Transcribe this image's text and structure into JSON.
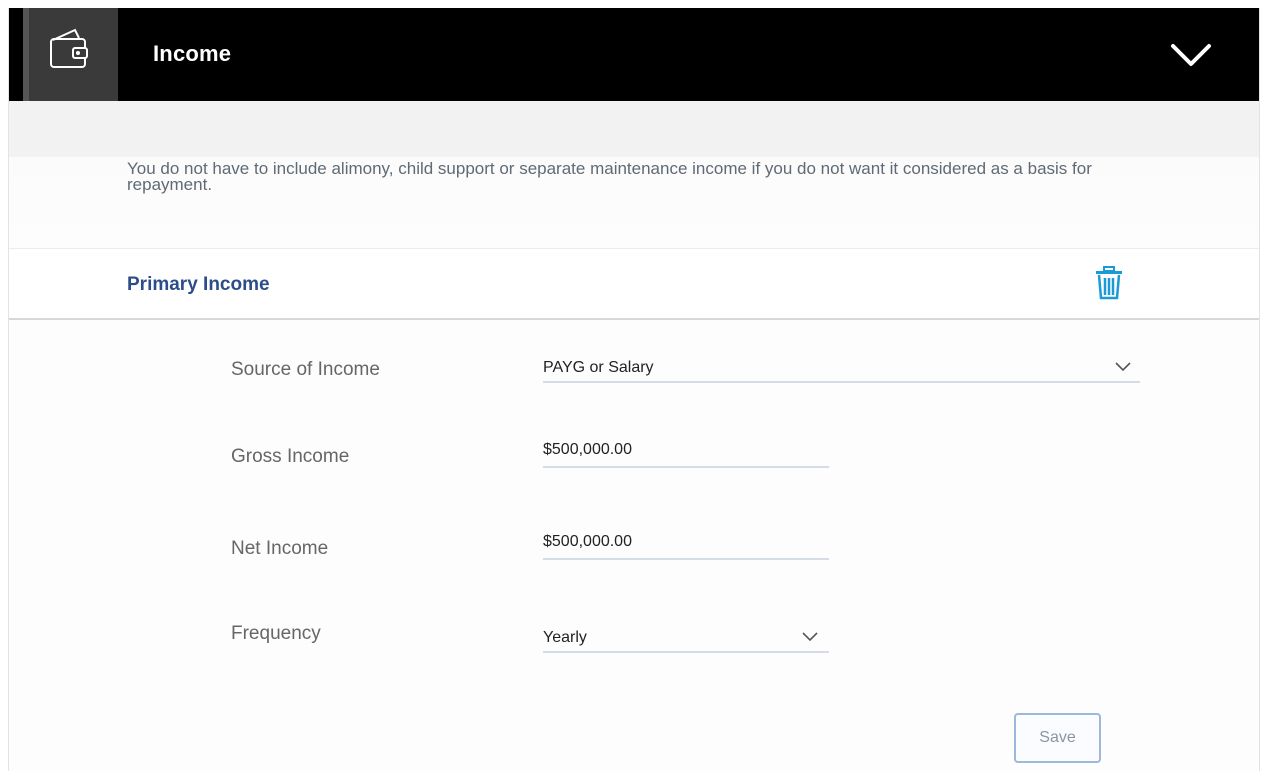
{
  "header": {
    "title": "Income",
    "icon": "wallet-icon",
    "toggle_icon": "chevron-down-icon"
  },
  "info": {
    "text": "You do not have to include alimony, child support or separate maintenance income if you do not want it considered as a basis for repayment."
  },
  "section": {
    "title": "Primary Income",
    "delete_icon": "trash-icon"
  },
  "form": {
    "source": {
      "label": "Source of Income",
      "value": "PAYG or Salary"
    },
    "gross": {
      "label": "Gross Income",
      "value": "$500,000.00"
    },
    "net": {
      "label": "Net Income",
      "value": "$500,000.00"
    },
    "frequency": {
      "label": "Frequency",
      "value": "Yearly"
    }
  },
  "actions": {
    "save_label": "Save"
  },
  "colors": {
    "header_bg": "#000000",
    "section_title": "#2d4d8a",
    "accent_icon": "#1a9ad6",
    "label_text": "#666666"
  }
}
